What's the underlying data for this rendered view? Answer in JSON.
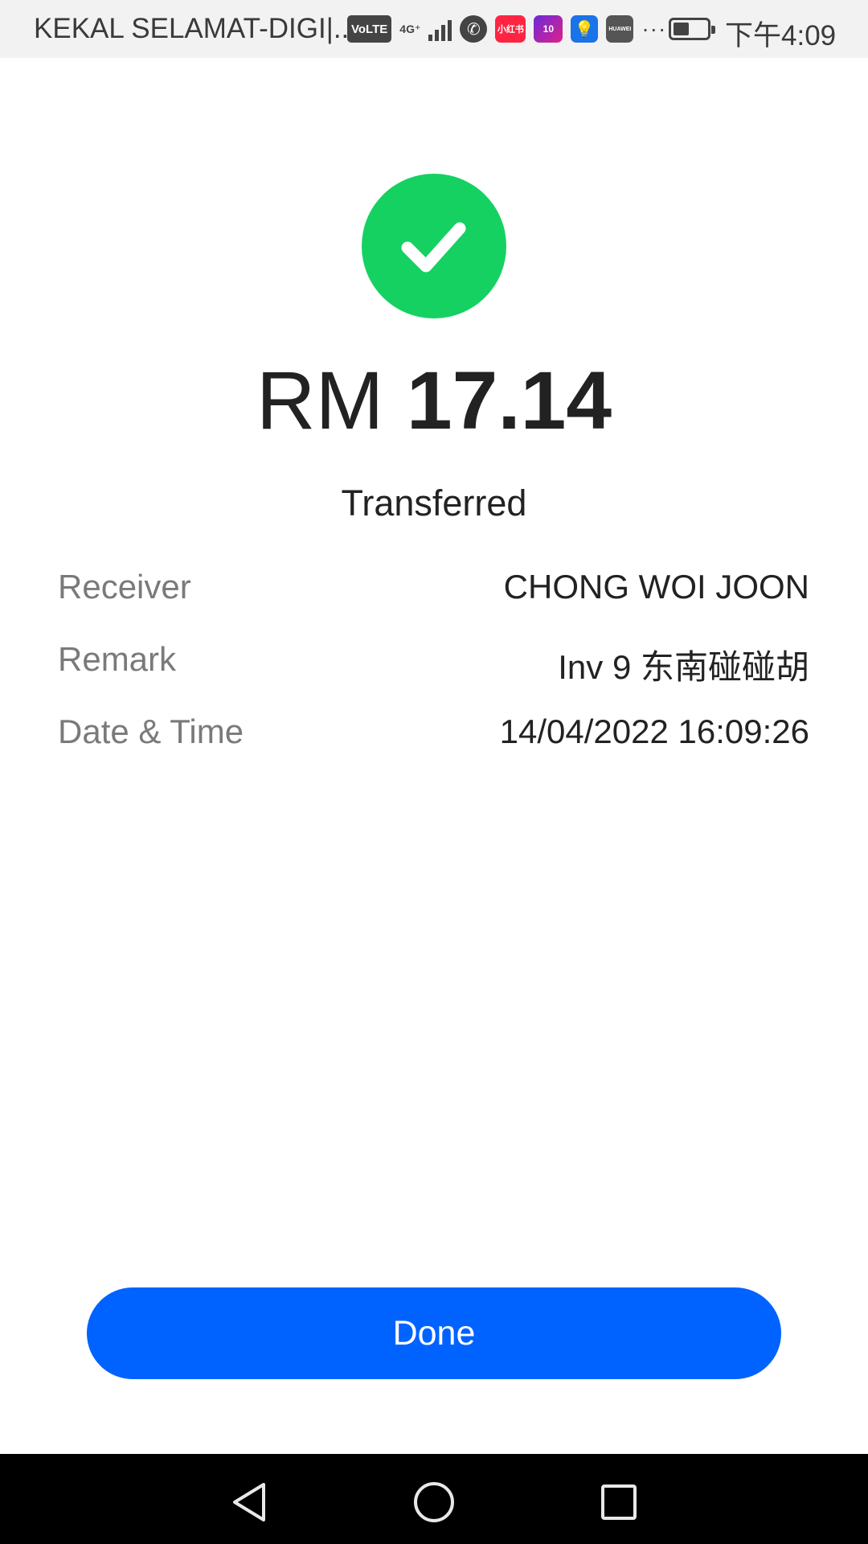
{
  "status_bar": {
    "carrier": "KEKAL SELAMAT-DIGI|...",
    "volte": "VoLTE",
    "network": "4G⁺",
    "app_badge_xhs": "小红书",
    "app_badge_lz": "10",
    "app_badge_huawei": "HUAWEI",
    "more": "···",
    "time": "下午4:09",
    "battery_level": 0.45
  },
  "transaction": {
    "currency": "RM",
    "amount": "17.14",
    "status": "Transferred"
  },
  "details": [
    {
      "label": "Receiver",
      "value": "CHONG WOI JOON"
    },
    {
      "label": "Remark",
      "value": "Inv 9 东南碰碰胡"
    },
    {
      "label": "Date & Time",
      "value": "14/04/2022 16:09:26"
    }
  ],
  "actions": {
    "done_label": "Done"
  },
  "colors": {
    "success": "#15d162",
    "primary": "#0163ff"
  },
  "icons": {
    "success": "checkmark-icon",
    "nav_back": "back-triangle-icon",
    "nav_home": "home-circle-icon",
    "nav_recents": "recents-square-icon"
  }
}
